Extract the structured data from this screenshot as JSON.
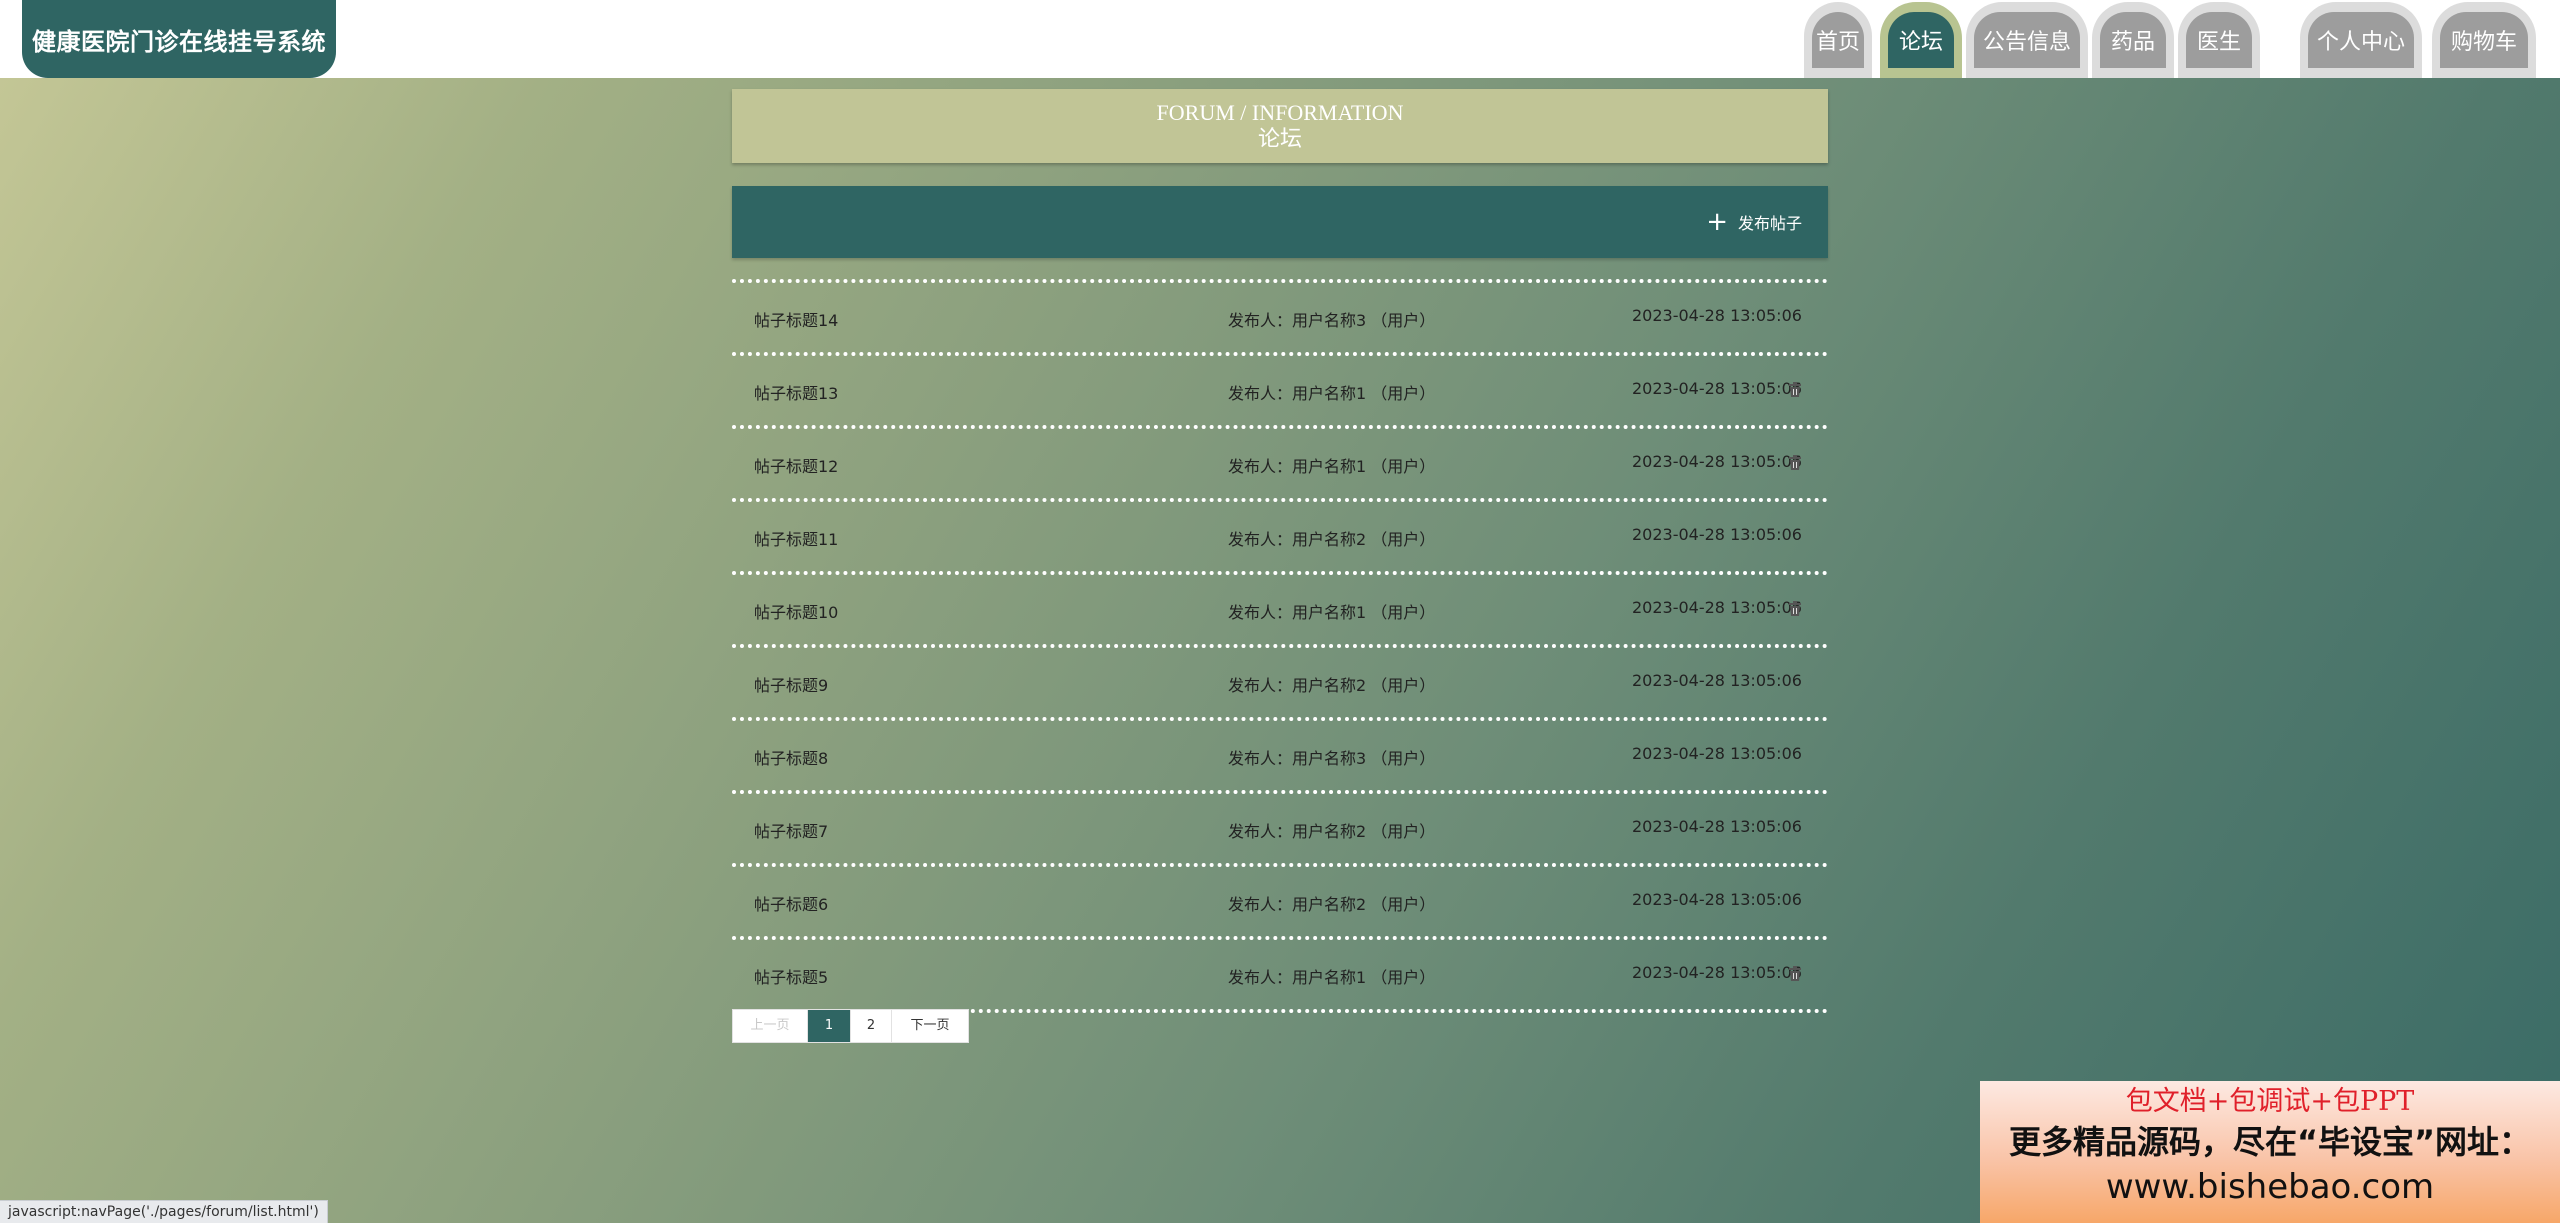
{
  "app": {
    "title": "健康医院门诊在线挂号系统"
  },
  "nav": {
    "items": [
      {
        "label": "首页"
      },
      {
        "label": "论坛"
      },
      {
        "label": "公告信息"
      },
      {
        "label": "药品"
      },
      {
        "label": "医生"
      },
      {
        "label": "个人中心"
      },
      {
        "label": "购物车"
      }
    ],
    "active": "论坛"
  },
  "page": {
    "title_en": "FORUM / INFORMATION",
    "title_cn": "论坛"
  },
  "actions": {
    "post_label": "发布帖子"
  },
  "posts": [
    {
      "title": "帖子标题14",
      "author": "发布人：用户名称3 （用户）",
      "time": "2023-04-28 13:05:06",
      "deletable": false
    },
    {
      "title": "帖子标题13",
      "author": "发布人：用户名称1 （用户）",
      "time": "2023-04-28 13:05:06",
      "deletable": true
    },
    {
      "title": "帖子标题12",
      "author": "发布人：用户名称1 （用户）",
      "time": "2023-04-28 13:05:06",
      "deletable": true
    },
    {
      "title": "帖子标题11",
      "author": "发布人：用户名称2 （用户）",
      "time": "2023-04-28 13:05:06",
      "deletable": false
    },
    {
      "title": "帖子标题10",
      "author": "发布人：用户名称1 （用户）",
      "time": "2023-04-28 13:05:06",
      "deletable": true
    },
    {
      "title": "帖子标题9",
      "author": "发布人：用户名称2 （用户）",
      "time": "2023-04-28 13:05:06",
      "deletable": false
    },
    {
      "title": "帖子标题8",
      "author": "发布人：用户名称3 （用户）",
      "time": "2023-04-28 13:05:06",
      "deletable": false
    },
    {
      "title": "帖子标题7",
      "author": "发布人：用户名称2 （用户）",
      "time": "2023-04-28 13:05:06",
      "deletable": false
    },
    {
      "title": "帖子标题6",
      "author": "发布人：用户名称2 （用户）",
      "time": "2023-04-28 13:05:06",
      "deletable": false
    },
    {
      "title": "帖子标题5",
      "author": "发布人：用户名称1 （用户）",
      "time": "2023-04-28 13:05:06",
      "deletable": true
    }
  ],
  "pagination": {
    "prev": "上一页",
    "pages": [
      "1",
      "2"
    ],
    "current": "1",
    "next": "下一页"
  },
  "statusbar": {
    "text": "javascript:navPage('./pages/forum/list.html')"
  },
  "ad": {
    "line1": "包文档+包调试+包PPT",
    "line2": "更多精品源码，尽在“毕设宝”网址：",
    "line3": "www.bishebao.com"
  },
  "colors": {
    "primary": "#2f6563",
    "title_bar": "#c1c596",
    "active_tab_outer": "#b8c491",
    "tab_inner": "#9d9d9d"
  },
  "icons": {
    "delete": "trash-icon",
    "post": "plus-icon"
  }
}
